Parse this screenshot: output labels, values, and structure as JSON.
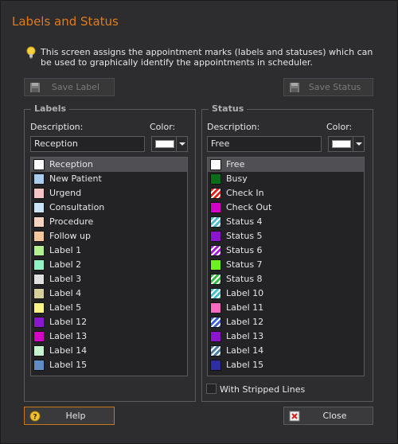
{
  "window": {
    "title": "Labels and Status"
  },
  "info": {
    "text": "This screen assigns the appointment marks (labels and statuses) which can be used to graphically identify the appointments in  scheduler."
  },
  "toolbar": {
    "save_label": "Save Label",
    "save_status": "Save Status"
  },
  "labels": {
    "group_title": "Labels",
    "description_label": "Description:",
    "color_label": "Color:",
    "description_value": "Reception",
    "selected_color": "#ffffff",
    "items": [
      {
        "name": "Reception",
        "color": "#ffffff",
        "selected": true
      },
      {
        "name": "New Patient",
        "color": "#a9cdf0"
      },
      {
        "name": "Urgend",
        "color": "#f5c4c4"
      },
      {
        "name": "Consultation",
        "color": "#cbe4f7"
      },
      {
        "name": "Procedure",
        "color": "#f7d3c2"
      },
      {
        "name": "Follow up",
        "color": "#f6c79a"
      },
      {
        "name": "Label 1",
        "color": "#b3f18e"
      },
      {
        "name": "Label 2",
        "color": "#8ff4c4"
      },
      {
        "name": "Label 3",
        "color": "#e0e0e0"
      },
      {
        "name": "Label 4",
        "color": "#d6cf9c"
      },
      {
        "name": "Label 5",
        "color": "#fbf584"
      },
      {
        "name": "Label 12",
        "color": "#8a17cc"
      },
      {
        "name": "Label 13",
        "color": "#d400c9"
      },
      {
        "name": "Label 14",
        "color": "#c7f5cf"
      },
      {
        "name": "Label 15",
        "color": "#5f8ec7"
      }
    ]
  },
  "status": {
    "group_title": "Status",
    "description_label": "Description:",
    "color_label": "Color:",
    "description_value": "Free",
    "selected_color": "#ffffff",
    "items": [
      {
        "name": "Free",
        "color": "#ffffff",
        "pattern": "solid",
        "selected": true
      },
      {
        "name": "Busy",
        "color": "#0b6d18",
        "pattern": "solid"
      },
      {
        "name": "Check In",
        "color": "#e01b1b",
        "pattern": "striped"
      },
      {
        "name": "Check Out",
        "color": "#d400c9",
        "pattern": "solid"
      },
      {
        "name": "Status 4",
        "color": "#4bb8d0",
        "pattern": "striped"
      },
      {
        "name": "Status 5",
        "color": "#8a17cc",
        "pattern": "solid"
      },
      {
        "name": "Status 6",
        "color": "#a21bd6",
        "pattern": "striped"
      },
      {
        "name": "Status 7",
        "color": "#6ef020",
        "pattern": "solid"
      },
      {
        "name": "Status 8",
        "color": "#32b840",
        "pattern": "striped"
      },
      {
        "name": "Label 10",
        "color": "#42bcd0",
        "pattern": "striped"
      },
      {
        "name": "Label 11",
        "color": "#f56cc0",
        "pattern": "solid"
      },
      {
        "name": "Label 12",
        "color": "#3a5fd0",
        "pattern": "striped"
      },
      {
        "name": "Label 13",
        "color": "#8a17cc",
        "pattern": "solid"
      },
      {
        "name": "Label 14",
        "color": "#4a7aa8",
        "pattern": "striped"
      },
      {
        "name": "Label 15",
        "color": "#2d2ea0",
        "pattern": "solid"
      }
    ],
    "stripped_lines_label": "With Stripped Lines",
    "stripped_lines_checked": false
  },
  "footer": {
    "help_label": "Help",
    "close_label": "Close"
  },
  "colors": {
    "accent": "#e07b1a",
    "focus_border": "#c97818"
  }
}
